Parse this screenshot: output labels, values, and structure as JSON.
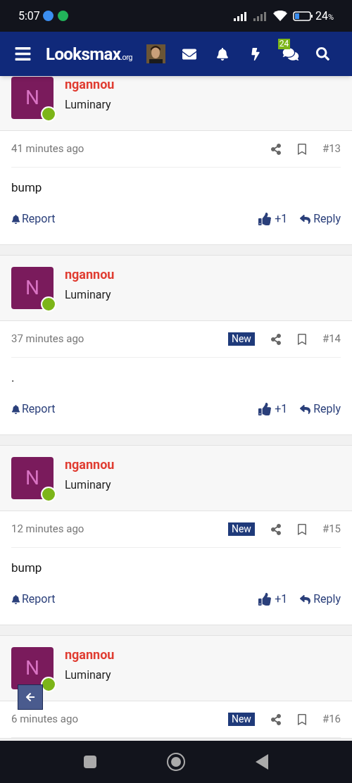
{
  "status_bar": {
    "time": "5:07",
    "battery": "24",
    "battery_unit": "%"
  },
  "header": {
    "logo": "Looksmax",
    "logo_suffix": ".org",
    "conversations_badge": "24"
  },
  "posts": [
    {
      "avatar_letter": "N",
      "author": "ngannou",
      "rank": "Luminary",
      "online": true,
      "time": "41 minutes ago",
      "is_new": false,
      "number": "#13",
      "body": "bump",
      "report": "Report",
      "likes": "+1",
      "reply": "Reply"
    },
    {
      "avatar_letter": "N",
      "author": "ngannou",
      "rank": "Luminary",
      "online": true,
      "time": "37 minutes ago",
      "is_new": true,
      "new_label": "New",
      "number": "#14",
      "body": ".",
      "report": "Report",
      "likes": "+1",
      "reply": "Reply"
    },
    {
      "avatar_letter": "N",
      "author": "ngannou",
      "rank": "Luminary",
      "online": true,
      "time": "12 minutes ago",
      "is_new": true,
      "new_label": "New",
      "number": "#15",
      "body": "bump",
      "report": "Report",
      "likes": "+1",
      "reply": "Reply"
    },
    {
      "avatar_letter": "N",
      "author": "ngannou",
      "rank": "Luminary",
      "online": true,
      "time": "6 minutes ago",
      "is_new": true,
      "new_label": "New",
      "number": "#16"
    }
  ]
}
